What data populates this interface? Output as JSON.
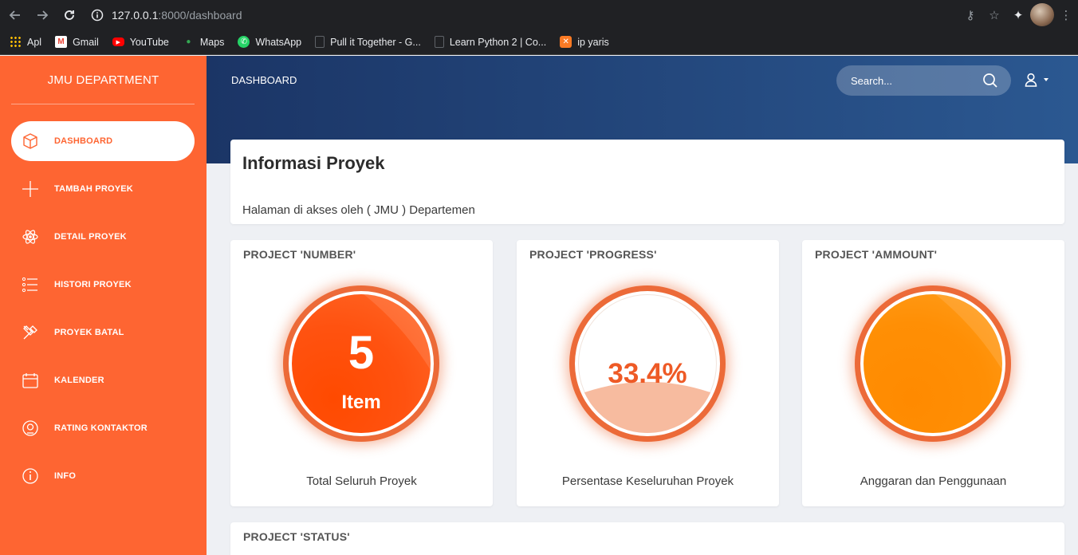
{
  "browser": {
    "url_host": "127.0.0.1",
    "url_path": ":8000/dashboard",
    "bookmarks": [
      {
        "label": "Apl",
        "icon": "apps-grid-icon",
        "color": "#e8eaed"
      },
      {
        "label": "Gmail",
        "icon": "gmail-icon",
        "color": "#ea4335"
      },
      {
        "label": "YouTube",
        "icon": "youtube-icon",
        "color": "#ff0000"
      },
      {
        "label": "Maps",
        "icon": "maps-pin-icon",
        "color": "#34a853"
      },
      {
        "label": "WhatsApp",
        "icon": "whatsapp-icon",
        "color": "#25d366"
      },
      {
        "label": "Pull it Together - G...",
        "icon": "doc-icon",
        "color": "#5f6368"
      },
      {
        "label": "Learn Python 2 | Co...",
        "icon": "doc-icon",
        "color": "#5f6368"
      },
      {
        "label": "ip yaris",
        "icon": "xampp-icon",
        "color": "#fb7a24"
      }
    ]
  },
  "sidebar": {
    "brand": "JMU DEPARTMENT",
    "accent": "#fe6532",
    "items": [
      {
        "label": "DASHBOARD",
        "icon": "box-icon",
        "active": true
      },
      {
        "label": "TAMBAH PROYEK",
        "icon": "plus-icon",
        "active": false
      },
      {
        "label": "DETAIL PROYEK",
        "icon": "atom-icon",
        "active": false
      },
      {
        "label": "HISTORI PROYEK",
        "icon": "list-icon",
        "active": false
      },
      {
        "label": "PROYEK BATAL",
        "icon": "tools-icon",
        "active": false
      },
      {
        "label": "KALENDER",
        "icon": "calendar-icon",
        "active": false
      },
      {
        "label": "RATING KONTAKTOR",
        "icon": "badge-icon",
        "active": false
      },
      {
        "label": "INFO",
        "icon": "info-icon",
        "active": false
      }
    ]
  },
  "header": {
    "title": "DASHBOARD",
    "search_placeholder": "Search...",
    "hero_colors": [
      "#1b3566",
      "#2b5891"
    ]
  },
  "info": {
    "title": "Informasi Proyek",
    "subtitle": "Halaman di akses oleh ( JMU ) Departemen"
  },
  "stats": [
    {
      "title": "PROJECT 'NUMBER'",
      "value": "5",
      "unit": "Item",
      "footer": "Total Seluruh Proyek"
    },
    {
      "title": "PROJECT 'PROGRESS'",
      "value": "33.4%",
      "progress": 0.334,
      "footer": "Persentase Keseluruhan Proyek"
    },
    {
      "title": "PROJECT 'AMMOUNT'",
      "footer": "Anggaran dan Penggunaan"
    }
  ],
  "status": {
    "title": "PROJECT 'STATUS'"
  }
}
